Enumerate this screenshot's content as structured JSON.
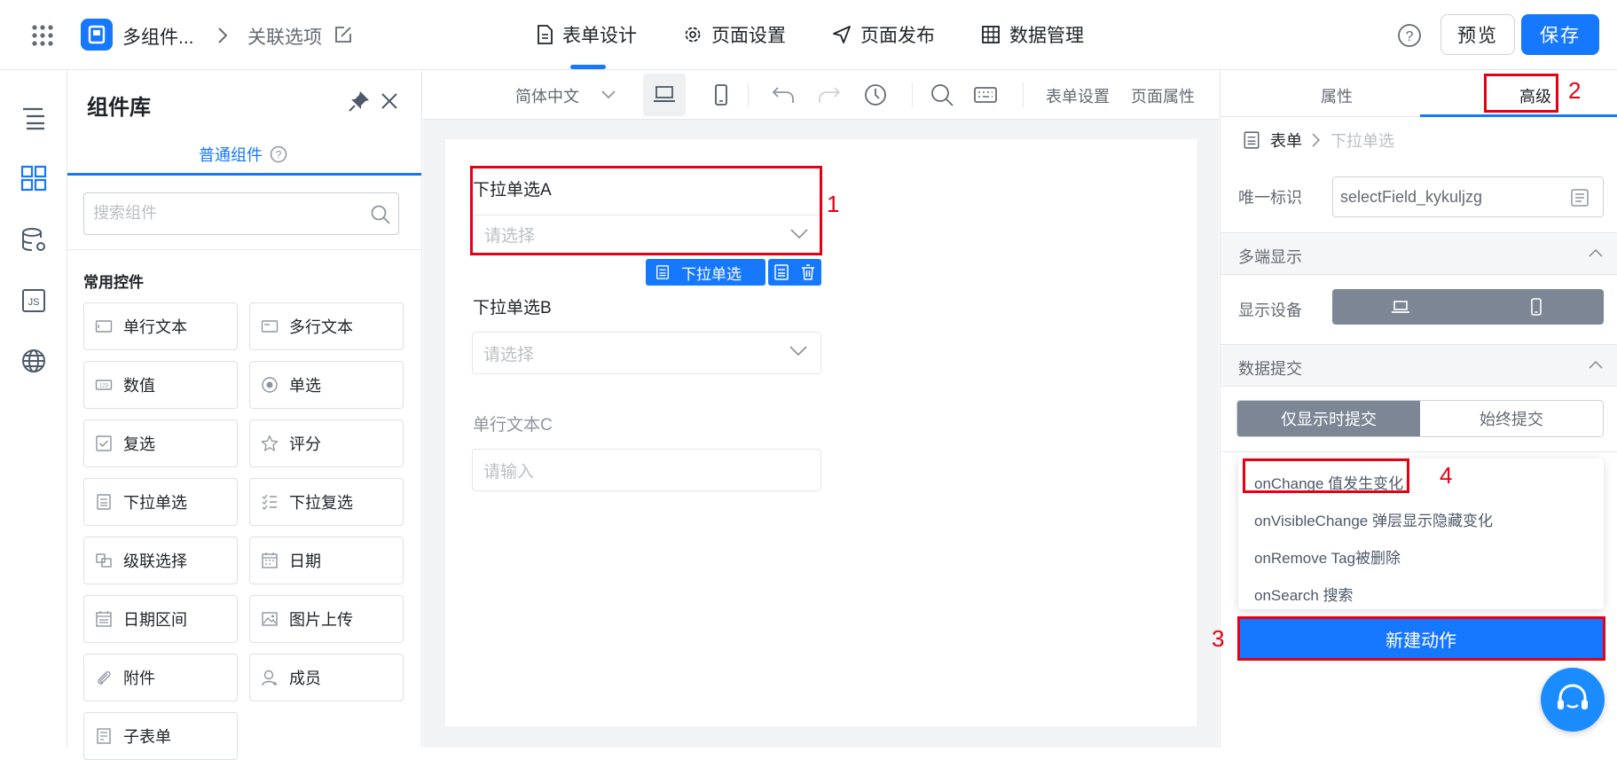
{
  "header": {
    "app_name": "多组件...",
    "breadcrumb_current": "关联选项",
    "tabs": [
      "表单设计",
      "页面设置",
      "页面发布",
      "数据管理"
    ],
    "preview_label": "预览",
    "save_label": "保存",
    "accent": "#1677ff"
  },
  "library": {
    "title": "组件库",
    "tab": "普通组件",
    "search_placeholder": "搜索组件",
    "section": "常用控件",
    "items": [
      "单行文本",
      "多行文本",
      "数值",
      "单选",
      "复选",
      "评分",
      "下拉单选",
      "下拉复选",
      "级联选择",
      "日期",
      "日期区间",
      "图片上传",
      "附件",
      "成员",
      "子表单"
    ]
  },
  "toolbar": {
    "language": "简体中文",
    "form_settings": "表单设置",
    "page_props": "页面属性"
  },
  "form": {
    "field_a_label": "下拉单选A",
    "field_a_placeholder": "请选择",
    "field_b_label": "下拉单选B",
    "field_b_placeholder": "请选择",
    "field_c_label": "单行文本C",
    "field_c_placeholder": "请输入",
    "selected_tag": "下拉单选"
  },
  "annotations": [
    "1",
    "2",
    "3",
    "4"
  ],
  "panel": {
    "tab_props": "属性",
    "tab_advanced": "高级",
    "crumb_root": "表单",
    "crumb_current": "下拉单选",
    "id_label": "唯一标识",
    "id_value": "selectField_kykuljzg",
    "multi_display": "多端显示",
    "display_device": "显示设备",
    "data_submit": "数据提交",
    "submit_visible": "仅显示时提交",
    "submit_always": "始终提交",
    "events": [
      "onChange 值发生变化",
      "onVisibleChange 弹层显示隐藏变化",
      "onRemove Tag被删除",
      "onSearch 搜索"
    ],
    "new_action": "新建动作"
  }
}
